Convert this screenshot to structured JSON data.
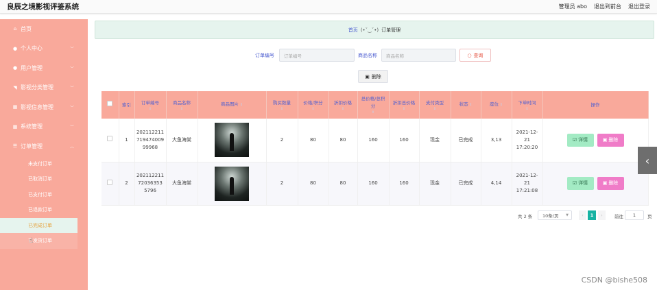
{
  "header": {
    "title": "良辰之境影视评鉴系统",
    "admin": "管理员 abo",
    "back_front": "退出到前台",
    "logout": "退出登录"
  },
  "sidebar": {
    "items": [
      {
        "icon": "home-icon",
        "glyph": "⌂",
        "label": "首页",
        "chevron": false
      },
      {
        "icon": "person-icon",
        "glyph": "●",
        "label": "个人中心",
        "chevron": true
      },
      {
        "icon": "user-icon",
        "glyph": "●",
        "label": "用户管理",
        "chevron": true
      },
      {
        "icon": "send-icon",
        "glyph": "◥",
        "label": "影视分类管理",
        "chevron": true
      },
      {
        "icon": "grid-icon",
        "glyph": "▦",
        "label": "影视信息管理",
        "chevron": true
      },
      {
        "icon": "grid-icon",
        "glyph": "▦",
        "label": "系统管理",
        "chevron": true
      },
      {
        "icon": "list-icon",
        "glyph": "☰",
        "label": "订单管理",
        "chevron": true
      }
    ],
    "sub_items": [
      "未支付订单",
      "已取消订单",
      "已支付订单",
      "已退款订单",
      "已完成订单",
      "已发货订单"
    ]
  },
  "breadcrumb": {
    "home": "首页",
    "sep": "(•ˇ‿ˇ•)",
    "current": "订单管理"
  },
  "search": {
    "order_label": "订单编号",
    "order_placeholder": "订单编号",
    "product_label": "商品名称",
    "product_placeholder": "商品名称",
    "query_label": "查询"
  },
  "toolbar": {
    "delete_label": "删除"
  },
  "table": {
    "headers": [
      "索引",
      "订单编号",
      "商品名称",
      "商品图片",
      "购买数量",
      "价格/积分",
      "折扣价格",
      "总价格/总积分",
      "折扣总价格",
      "支付类型",
      "状态",
      "座位",
      "下单时间",
      "操作"
    ],
    "rows": [
      {
        "index": "1",
        "order_no": "20211221171947400999968",
        "product": "大鱼海棠",
        "qty": "2",
        "price": "80",
        "discount": "80",
        "total": "160",
        "discount_total": "160",
        "pay": "现金",
        "status": "已完成",
        "seat": "3,13",
        "time": "2021-12-21 17:20:20"
      },
      {
        "index": "2",
        "order_no": "20211221172036353 5796",
        "product": "大鱼海棠",
        "qty": "2",
        "price": "80",
        "discount": "80",
        "total": "160",
        "discount_total": "160",
        "pay": "现金",
        "status": "已完成",
        "seat": "4,14",
        "time": "2021-12-21 17:21:08"
      }
    ],
    "detail_label": "详情",
    "delete_label": "删除"
  },
  "pagination": {
    "total": "共 2 条",
    "page_size": "10条/页",
    "current": "1",
    "goto": "前往",
    "goto_value": "1",
    "page_suffix": "页"
  },
  "watermark": "CSDN @bishe508"
}
